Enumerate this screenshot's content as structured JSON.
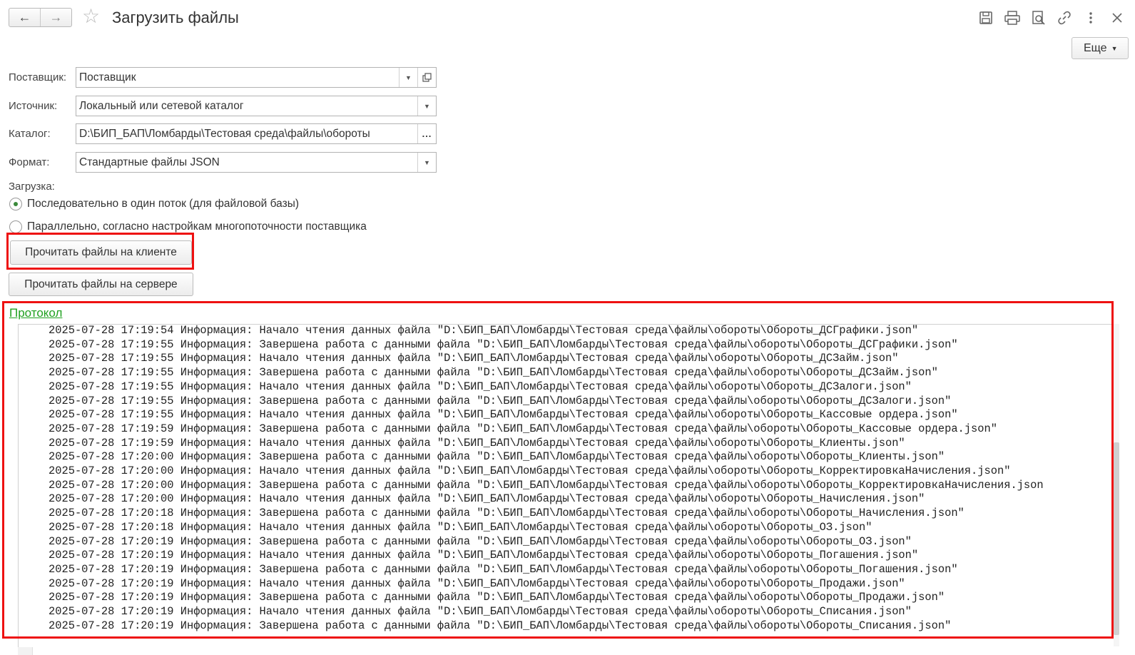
{
  "header": {
    "title": "Загрузить файлы",
    "more_label": "Еще",
    "icons": [
      "save-icon",
      "print-icon",
      "preview-icon",
      "link-icon",
      "menu-dots-icon"
    ]
  },
  "form": {
    "supplier": {
      "label": "Поставщик:",
      "value": "Поставщик"
    },
    "source": {
      "label": "Источник:",
      "value": "Локальный или сетевой каталог"
    },
    "catalog": {
      "label": "Каталог:",
      "value": "D:\\БИП_БАП\\Ломбарды\\Тестовая среда\\файлы\\обороты"
    },
    "format": {
      "label": "Формат:",
      "value": "Стандартные файлы JSON"
    },
    "load_label": "Загрузка:",
    "radio_options": [
      {
        "label": "Последовательно в один поток (для файловой базы)",
        "selected": true
      },
      {
        "label": "Параллельно, согласно настройкам многопоточности поставщика",
        "selected": false
      }
    ],
    "read_client_label": "Прочитать файлы на клиенте",
    "read_server_label": "Прочитать файлы на сервере"
  },
  "protocol": {
    "title": "Протокол",
    "lines": [
      "2025-07-28 17:19:54 Информация: Начало чтения данных файла \"D:\\БИП_БАП\\Ломбарды\\Тестовая среда\\файлы\\обороты\\Обороты_ДСГрафики.json\"",
      "2025-07-28 17:19:55 Информация: Завершена работа с данными файла \"D:\\БИП_БАП\\Ломбарды\\Тестовая среда\\файлы\\обороты\\Обороты_ДСГрафики.json\"",
      "2025-07-28 17:19:55 Информация: Начало чтения данных файла \"D:\\БИП_БАП\\Ломбарды\\Тестовая среда\\файлы\\обороты\\Обороты_ДСЗайм.json\"",
      "2025-07-28 17:19:55 Информация: Завершена работа с данными файла \"D:\\БИП_БАП\\Ломбарды\\Тестовая среда\\файлы\\обороты\\Обороты_ДСЗайм.json\"",
      "2025-07-28 17:19:55 Информация: Начало чтения данных файла \"D:\\БИП_БАП\\Ломбарды\\Тестовая среда\\файлы\\обороты\\Обороты_ДСЗалоги.json\"",
      "2025-07-28 17:19:55 Информация: Завершена работа с данными файла \"D:\\БИП_БАП\\Ломбарды\\Тестовая среда\\файлы\\обороты\\Обороты_ДСЗалоги.json\"",
      "2025-07-28 17:19:55 Информация: Начало чтения данных файла \"D:\\БИП_БАП\\Ломбарды\\Тестовая среда\\файлы\\обороты\\Обороты_Кассовые ордера.json\"",
      "2025-07-28 17:19:59 Информация: Завершена работа с данными файла \"D:\\БИП_БАП\\Ломбарды\\Тестовая среда\\файлы\\обороты\\Обороты_Кассовые ордера.json\"",
      "2025-07-28 17:19:59 Информация: Начало чтения данных файла \"D:\\БИП_БАП\\Ломбарды\\Тестовая среда\\файлы\\обороты\\Обороты_Клиенты.json\"",
      "2025-07-28 17:20:00 Информация: Завершена работа с данными файла \"D:\\БИП_БАП\\Ломбарды\\Тестовая среда\\файлы\\обороты\\Обороты_Клиенты.json\"",
      "2025-07-28 17:20:00 Информация: Начало чтения данных файла \"D:\\БИП_БАП\\Ломбарды\\Тестовая среда\\файлы\\обороты\\Обороты_КорректировкаНачисления.json\"",
      "2025-07-28 17:20:00 Информация: Завершена работа с данными файла \"D:\\БИП_БАП\\Ломбарды\\Тестовая среда\\файлы\\обороты\\Обороты_КорректировкаНачисления.json",
      "2025-07-28 17:20:00 Информация: Начало чтения данных файла \"D:\\БИП_БАП\\Ломбарды\\Тестовая среда\\файлы\\обороты\\Обороты_Начисления.json\"",
      "2025-07-28 17:20:18 Информация: Завершена работа с данными файла \"D:\\БИП_БАП\\Ломбарды\\Тестовая среда\\файлы\\обороты\\Обороты_Начисления.json\"",
      "2025-07-28 17:20:18 Информация: Начало чтения данных файла \"D:\\БИП_БАП\\Ломбарды\\Тестовая среда\\файлы\\обороты\\Обороты_ОЗ.json\"",
      "2025-07-28 17:20:19 Информация: Завершена работа с данными файла \"D:\\БИП_БАП\\Ломбарды\\Тестовая среда\\файлы\\обороты\\Обороты_ОЗ.json\"",
      "2025-07-28 17:20:19 Информация: Начало чтения данных файла \"D:\\БИП_БАП\\Ломбарды\\Тестовая среда\\файлы\\обороты\\Обороты_Погашения.json\"",
      "2025-07-28 17:20:19 Информация: Завершена работа с данными файла \"D:\\БИП_БАП\\Ломбарды\\Тестовая среда\\файлы\\обороты\\Обороты_Погашения.json\"",
      "2025-07-28 17:20:19 Информация: Начало чтения данных файла \"D:\\БИП_БАП\\Ломбарды\\Тестовая среда\\файлы\\обороты\\Обороты_Продажи.json\"",
      "2025-07-28 17:20:19 Информация: Завершена работа с данными файла \"D:\\БИП_БАП\\Ломбарды\\Тестовая среда\\файлы\\обороты\\Обороты_Продажи.json\"",
      "2025-07-28 17:20:19 Информация: Начало чтения данных файла \"D:\\БИП_БАП\\Ломбарды\\Тестовая среда\\файлы\\обороты\\Обороты_Списания.json\"",
      "2025-07-28 17:20:19 Информация: Завершена работа с данными файла \"D:\\БИП_БАП\\Ломбарды\\Тестовая среда\\файлы\\обороты\\Обороты_Списания.json\""
    ]
  },
  "colors": {
    "highlight": "#ee1111",
    "protocol_link": "#21a121",
    "radio_selected": "#3a8a3a"
  }
}
